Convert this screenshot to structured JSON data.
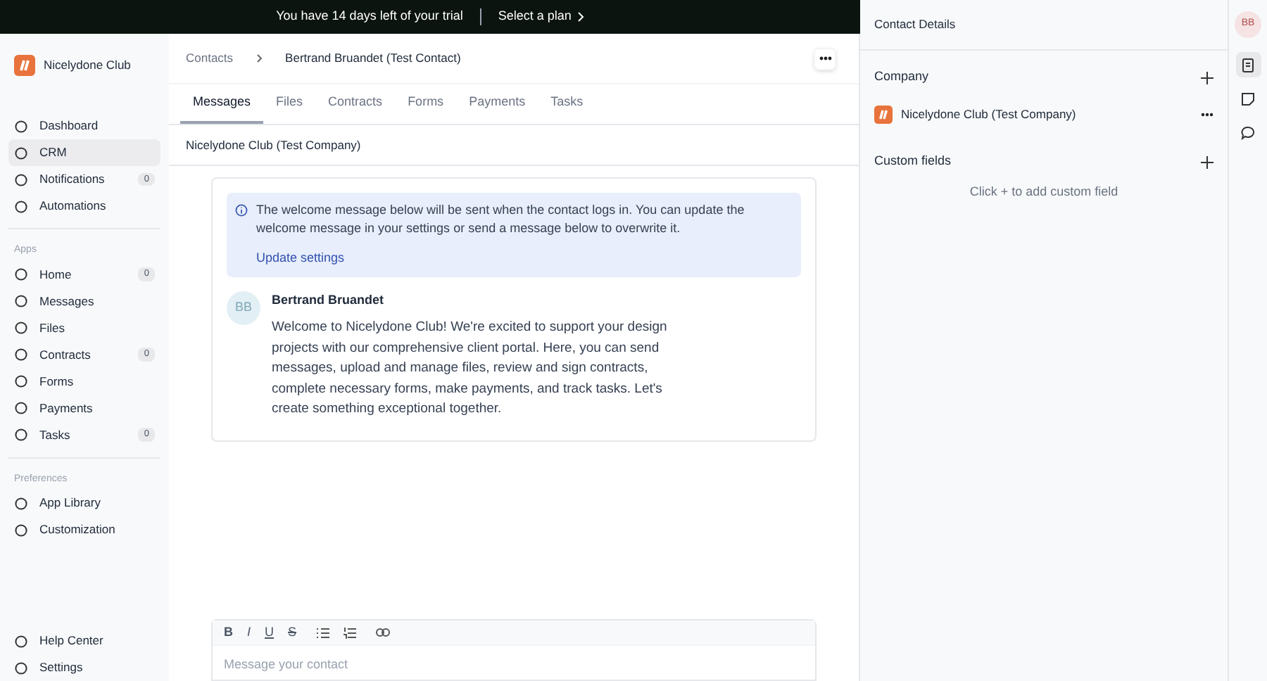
{
  "trial_banner": {
    "message": "You have 14 days left of your trial",
    "link": "Select a plan"
  },
  "sidebar": {
    "workspace": "Nicelydone Club",
    "sections": [
      {
        "items": [
          {
            "label": "Dashboard",
            "selected": false
          },
          {
            "label": "CRM",
            "selected": true
          },
          {
            "label": "Notifications",
            "selected": false,
            "count": "0"
          },
          {
            "label": "Automations",
            "selected": false
          }
        ]
      },
      {
        "heading": "Apps",
        "items": [
          {
            "label": "Home",
            "selected": false,
            "count": "0"
          },
          {
            "label": "Messages",
            "selected": false
          },
          {
            "label": "Files",
            "selected": false
          },
          {
            "label": "Contracts",
            "selected": false,
            "count": "0"
          },
          {
            "label": "Forms",
            "selected": false
          },
          {
            "label": "Payments",
            "selected": false
          },
          {
            "label": "Tasks",
            "selected": false,
            "count": "0"
          }
        ]
      },
      {
        "heading": "Preferences",
        "items": [
          {
            "label": "App Library",
            "selected": false
          },
          {
            "label": "Customization",
            "selected": false
          }
        ]
      }
    ],
    "bottom_items": [
      {
        "label": "Help Center",
        "selected": false
      },
      {
        "label": "Settings",
        "selected": false
      }
    ]
  },
  "breadcrumb": [
    "Contacts",
    "Bertrand Bruandet (Test Contact)"
  ],
  "tabs": [
    {
      "label": "Messages",
      "selected": true
    },
    {
      "label": "Files",
      "selected": false
    },
    {
      "label": "Contracts",
      "selected": false
    },
    {
      "label": "Forms",
      "selected": false
    },
    {
      "label": "Payments",
      "selected": false
    },
    {
      "label": "Tasks",
      "selected": false
    }
  ],
  "company_bar": "Nicelydone Club (Test Company)",
  "notice": {
    "text": "The welcome message below will be sent when the contact logs in. You can update the welcome message in your settings or send a message below to overwrite it.",
    "link": "Update settings"
  },
  "message": {
    "initials": "BB",
    "author": "Bertrand Bruandet",
    "body": "Welcome to Nicelydone Club! We're excited to support your design projects with our comprehensive client portal. Here, you can send messages, upload and manage files, review and sign contracts, complete necessary forms, make payments, and track tasks. Let's create something exceptional together."
  },
  "composer": {
    "toolbar": [
      "B",
      "I",
      "U",
      "S"
    ],
    "placeholder": "Message your contact"
  },
  "contact_details": {
    "title": "Contact Details",
    "company_heading": "Company",
    "company": "Nicelydone Club (Test Company)",
    "custom_fields_heading": "Custom fields",
    "custom_fields_hint": "Click + to add custom field"
  },
  "rail": {
    "initials": "BB",
    "tools": [
      {
        "selected": true
      },
      {
        "selected": false
      },
      {
        "selected": false
      }
    ]
  }
}
